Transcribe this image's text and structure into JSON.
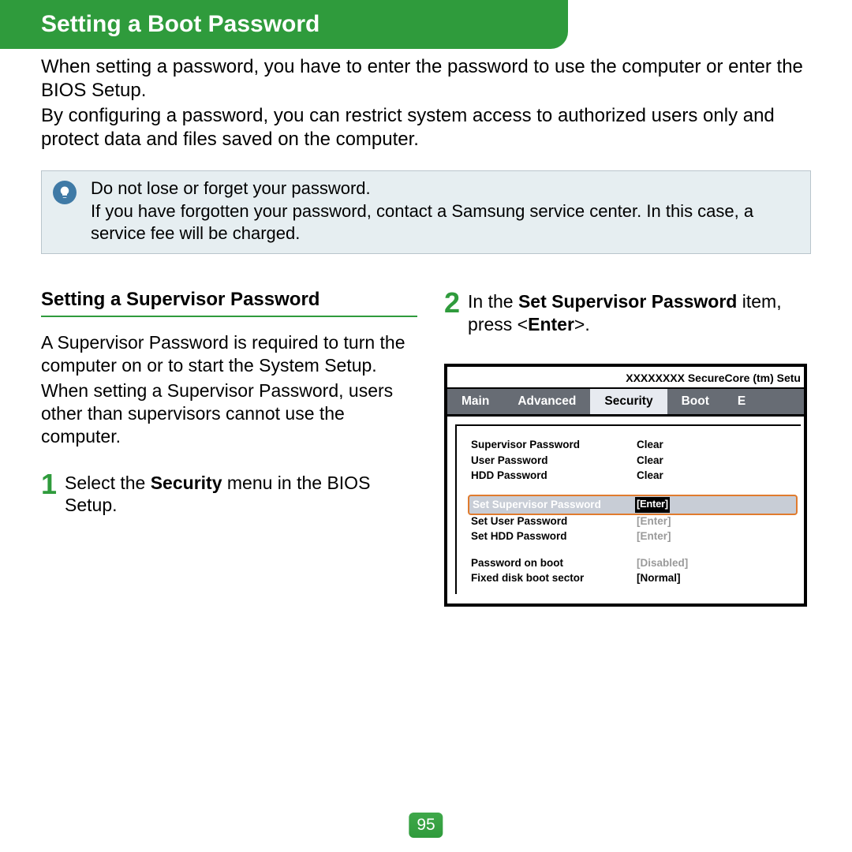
{
  "header": {
    "title": "Setting a Boot Password"
  },
  "intro": {
    "p1": "When setting a password, you have to enter the password to use the computer or enter the BIOS Setup.",
    "p2": "By configuring a password, you can restrict system access to authorized users only and protect data and files saved on the computer."
  },
  "tip": {
    "line1": "Do not lose or forget your password.",
    "line2": "If you have forgotten your password, contact a Samsung service center. In this case, a service fee will be charged."
  },
  "left": {
    "heading": "Setting a Supervisor Password",
    "p1": "A Supervisor Password is required to turn the computer on or to start the System Setup.",
    "p2": "When setting a Supervisor Password, users other than supervisors cannot use the computer.",
    "step1_num": "1",
    "step1_pre": "Select the ",
    "step1_bold": "Security",
    "step1_post": " menu in the BIOS Setup."
  },
  "right": {
    "step2_num": "2",
    "step2_pre": "In the ",
    "step2_bold": "Set Supervisor Password",
    "step2_mid": " item, press <",
    "step2_bold2": "Enter",
    "step2_post": ">."
  },
  "bios": {
    "title": "XXXXXXXX SecureCore (tm) Setu",
    "tabs": [
      "Main",
      "Advanced",
      "Security",
      "Boot",
      "E"
    ],
    "active_tab_index": 2,
    "rows": [
      {
        "lbl": "Supervisor Password",
        "val": "Clear",
        "gray": false
      },
      {
        "lbl": "User Password",
        "val": "Clear",
        "gray": false
      },
      {
        "lbl": "HDD Password",
        "val": "Clear",
        "gray": false
      }
    ],
    "highlight": {
      "lbl": "Set Supervisor Password",
      "val": "[Enter]"
    },
    "rows2": [
      {
        "lbl": "Set User Password",
        "val": "[Enter]",
        "gray": true
      },
      {
        "lbl": "Set HDD Password",
        "val": "[Enter]",
        "gray": true
      }
    ],
    "rows3": [
      {
        "lbl": "Password on boot",
        "val": "[Disabled]",
        "gray": true
      },
      {
        "lbl": "Fixed disk boot sector",
        "val": "[Normal]",
        "gray": false
      }
    ]
  },
  "page_number": "95"
}
